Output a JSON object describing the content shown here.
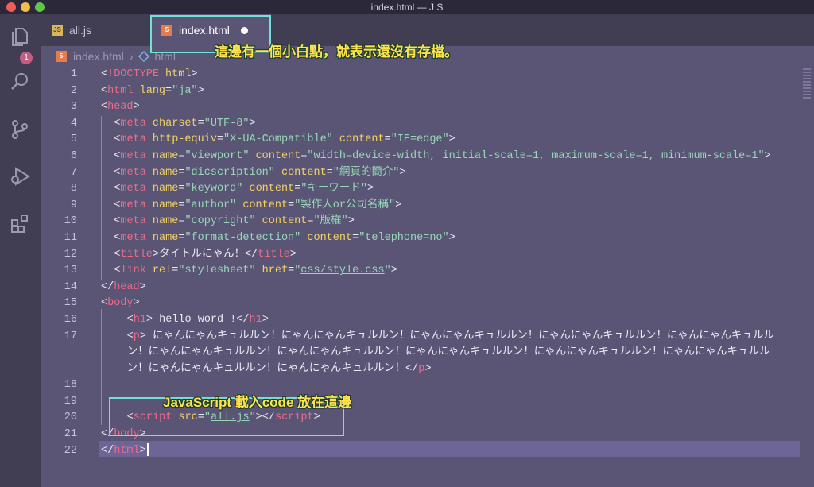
{
  "window": {
    "title": "index.html — J S",
    "traffic_lights": [
      "#ee5e57",
      "#f3bd4b",
      "#60c64a"
    ]
  },
  "activity_bar": {
    "items": [
      {
        "icon": "files-icon",
        "badge": "1"
      },
      {
        "icon": "search-icon"
      },
      {
        "icon": "source-control-icon"
      },
      {
        "icon": "debug-icon"
      },
      {
        "icon": "extensions-icon"
      }
    ]
  },
  "tabs": [
    {
      "icon_text": "JS",
      "label": "all.js"
    },
    {
      "icon_text": "5",
      "label": "index.html"
    }
  ],
  "breadcrumb": {
    "icon_text": "5",
    "file": "index.html",
    "separator": "›",
    "node": "html"
  },
  "annotations": {
    "top": "這邊有一個小白點，就表示還沒有存檔。",
    "bottom": "JavaScript  載入code 放在這邊"
  },
  "code_lines": [
    {
      "n": "1",
      "indent": 0,
      "tokens": [
        [
          "br",
          "<"
        ],
        [
          "kw",
          "!DOCTYPE"
        ],
        [
          "br",
          " "
        ],
        [
          "attr",
          "html"
        ],
        [
          "br",
          ">"
        ]
      ]
    },
    {
      "n": "2",
      "indent": 0,
      "tokens": [
        [
          "br",
          "<"
        ],
        [
          "tag",
          "html"
        ],
        [
          "br",
          " "
        ],
        [
          "attr",
          "lang"
        ],
        [
          "eq",
          "="
        ],
        [
          "str",
          "\"ja\""
        ],
        [
          "br",
          ">"
        ]
      ]
    },
    {
      "n": "3",
      "indent": 0,
      "tokens": [
        [
          "br",
          "<"
        ],
        [
          "tag",
          "head"
        ],
        [
          "br",
          ">"
        ]
      ]
    },
    {
      "n": "4",
      "indent": 1,
      "tokens": [
        [
          "br",
          "<"
        ],
        [
          "tag",
          "meta"
        ],
        [
          "br",
          " "
        ],
        [
          "attr",
          "charset"
        ],
        [
          "eq",
          "="
        ],
        [
          "str",
          "\"UTF-8\""
        ],
        [
          "br",
          ">"
        ]
      ]
    },
    {
      "n": "5",
      "indent": 1,
      "tokens": [
        [
          "br",
          "<"
        ],
        [
          "tag",
          "meta"
        ],
        [
          "br",
          " "
        ],
        [
          "attr",
          "http-equiv"
        ],
        [
          "eq",
          "="
        ],
        [
          "str",
          "\"X-UA-Compatible\""
        ],
        [
          "br",
          " "
        ],
        [
          "attr",
          "content"
        ],
        [
          "eq",
          "="
        ],
        [
          "str",
          "\"IE=edge\""
        ],
        [
          "br",
          ">"
        ]
      ]
    },
    {
      "n": "6",
      "indent": 1,
      "tokens": [
        [
          "br",
          "<"
        ],
        [
          "tag",
          "meta"
        ],
        [
          "br",
          " "
        ],
        [
          "attr",
          "name"
        ],
        [
          "eq",
          "="
        ],
        [
          "str",
          "\"viewport\""
        ],
        [
          "br",
          " "
        ],
        [
          "attr",
          "content"
        ],
        [
          "eq",
          "="
        ],
        [
          "str",
          "\"width=device-width, initial-scale=1, maximum-scale=1, minimum-scale=1\""
        ],
        [
          "br",
          ">"
        ]
      ]
    },
    {
      "n": "7",
      "indent": 1,
      "tokens": [
        [
          "br",
          "<"
        ],
        [
          "tag",
          "meta"
        ],
        [
          "br",
          " "
        ],
        [
          "attr",
          "name"
        ],
        [
          "eq",
          "="
        ],
        [
          "str",
          "\"dicscription\""
        ],
        [
          "br",
          " "
        ],
        [
          "attr",
          "content"
        ],
        [
          "eq",
          "="
        ],
        [
          "str",
          "\"網頁的簡介\""
        ],
        [
          "br",
          ">"
        ]
      ]
    },
    {
      "n": "8",
      "indent": 1,
      "tokens": [
        [
          "br",
          "<"
        ],
        [
          "tag",
          "meta"
        ],
        [
          "br",
          " "
        ],
        [
          "attr",
          "name"
        ],
        [
          "eq",
          "="
        ],
        [
          "str",
          "\"keyword\""
        ],
        [
          "br",
          " "
        ],
        [
          "attr",
          "content"
        ],
        [
          "eq",
          "="
        ],
        [
          "str",
          "\"キーワード\""
        ],
        [
          "br",
          ">"
        ]
      ]
    },
    {
      "n": "9",
      "indent": 1,
      "tokens": [
        [
          "br",
          "<"
        ],
        [
          "tag",
          "meta"
        ],
        [
          "br",
          " "
        ],
        [
          "attr",
          "name"
        ],
        [
          "eq",
          "="
        ],
        [
          "str",
          "\"author\""
        ],
        [
          "br",
          " "
        ],
        [
          "attr",
          "content"
        ],
        [
          "eq",
          "="
        ],
        [
          "str",
          "\"製作人or公司名稱\""
        ],
        [
          "br",
          ">"
        ]
      ]
    },
    {
      "n": "10",
      "indent": 1,
      "tokens": [
        [
          "br",
          "<"
        ],
        [
          "tag",
          "meta"
        ],
        [
          "br",
          " "
        ],
        [
          "attr",
          "name"
        ],
        [
          "eq",
          "="
        ],
        [
          "str",
          "\"copyright\""
        ],
        [
          "br",
          " "
        ],
        [
          "attr",
          "content"
        ],
        [
          "eq",
          "="
        ],
        [
          "str",
          "\"版權\""
        ],
        [
          "br",
          ">"
        ]
      ]
    },
    {
      "n": "11",
      "indent": 1,
      "tokens": [
        [
          "br",
          "<"
        ],
        [
          "tag",
          "meta"
        ],
        [
          "br",
          " "
        ],
        [
          "attr",
          "name"
        ],
        [
          "eq",
          "="
        ],
        [
          "str",
          "\"format-detection\""
        ],
        [
          "br",
          " "
        ],
        [
          "attr",
          "content"
        ],
        [
          "eq",
          "="
        ],
        [
          "str",
          "\"telephone=no\""
        ],
        [
          "br",
          ">"
        ]
      ]
    },
    {
      "n": "12",
      "indent": 1,
      "tokens": [
        [
          "br",
          "<"
        ],
        [
          "tag",
          "title"
        ],
        [
          "br",
          ">タイトルにゃん！</"
        ],
        [
          "tag",
          "title"
        ],
        [
          "br",
          ">"
        ]
      ]
    },
    {
      "n": "13",
      "indent": 1,
      "tokens": [
        [
          "br",
          "<"
        ],
        [
          "tag",
          "link"
        ],
        [
          "br",
          " "
        ],
        [
          "attr",
          "rel"
        ],
        [
          "eq",
          "="
        ],
        [
          "str",
          "\"stylesheet\""
        ],
        [
          "br",
          " "
        ],
        [
          "attr",
          "href"
        ],
        [
          "eq",
          "="
        ],
        [
          "str",
          "\""
        ],
        [
          "strlink",
          "css/style.css"
        ],
        [
          "str",
          "\""
        ],
        [
          "br",
          ">"
        ]
      ]
    },
    {
      "n": "14",
      "indent": 0,
      "tokens": [
        [
          "br",
          "</"
        ],
        [
          "tag",
          "head"
        ],
        [
          "br",
          ">"
        ]
      ]
    },
    {
      "n": "15",
      "indent": 0,
      "tokens": [
        [
          "br",
          "<"
        ],
        [
          "tag",
          "body"
        ],
        [
          "br",
          ">"
        ]
      ]
    },
    {
      "n": "16",
      "indent": 2,
      "tokens": [
        [
          "br",
          "<"
        ],
        [
          "tag",
          "h1"
        ],
        [
          "br",
          "> hello word !</"
        ],
        [
          "tag",
          "h1"
        ],
        [
          "br",
          ">"
        ]
      ]
    },
    {
      "n": "17",
      "indent": 2,
      "tokens": [
        [
          "br",
          "<"
        ],
        [
          "tag",
          "p"
        ],
        [
          "br",
          "> にゃんにゃんキュルルン！にゃんにゃんキュルルン！にゃんにゃんキュルルン！にゃんにゃんキュルルン！にゃんにゃんキュルル"
        ]
      ]
    },
    {
      "n": "",
      "indent": 2,
      "wrap": true,
      "tokens": [
        [
          "br",
          "ン！にゃんにゃんキュルルン！にゃんにゃんキュルルン！にゃんにゃんキュルルン！にゃんにゃんキュルルン！にゃんにゃんキュルル"
        ]
      ]
    },
    {
      "n": "",
      "indent": 2,
      "wrap": true,
      "tokens": [
        [
          "br",
          "ン！にゃんにゃんキュルルン！にゃんにゃんキュルルン！</"
        ],
        [
          "tag",
          "p"
        ],
        [
          "br",
          ">"
        ]
      ]
    },
    {
      "n": "18",
      "indent": 0,
      "tokens": []
    },
    {
      "n": "19",
      "indent": 0,
      "tokens": []
    },
    {
      "n": "20",
      "indent": 2,
      "tokens": [
        [
          "br",
          "<"
        ],
        [
          "tag",
          "script"
        ],
        [
          "br",
          " "
        ],
        [
          "attr",
          "src"
        ],
        [
          "eq",
          "="
        ],
        [
          "str",
          "\""
        ],
        [
          "strlink",
          "all.js"
        ],
        [
          "str",
          "\""
        ],
        [
          "br",
          "></"
        ],
        [
          "tag",
          "script"
        ],
        [
          "br",
          ">"
        ]
      ]
    },
    {
      "n": "21",
      "indent": 0,
      "tokens": [
        [
          "br",
          "</"
        ],
        [
          "tag",
          "body"
        ],
        [
          "br",
          ">"
        ]
      ]
    },
    {
      "n": "22",
      "indent": 0,
      "tokens": [
        [
          "br",
          "</"
        ],
        [
          "tag",
          "html"
        ],
        [
          "br",
          ">"
        ]
      ]
    }
  ]
}
